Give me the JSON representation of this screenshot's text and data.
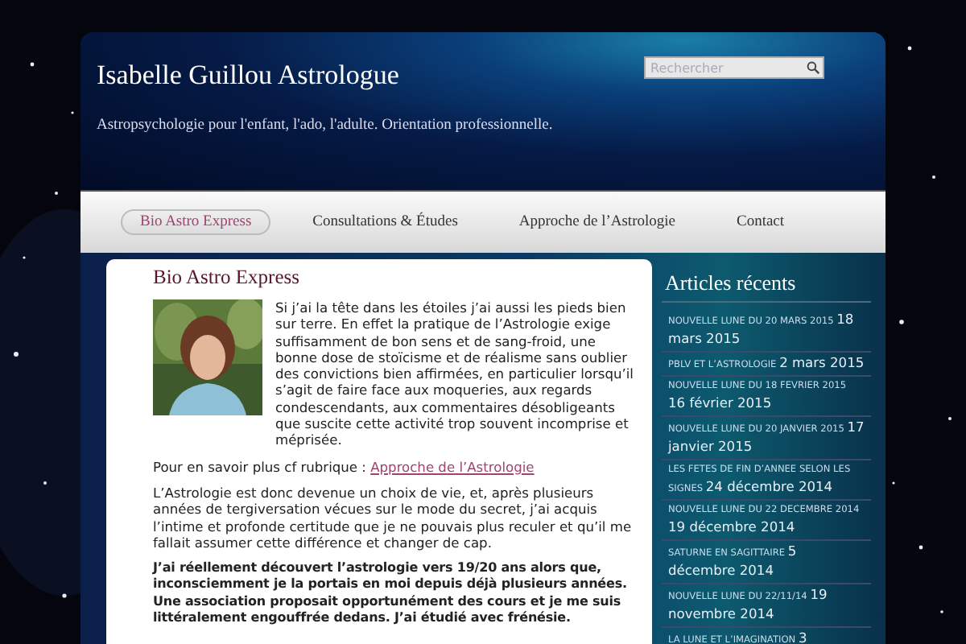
{
  "site": {
    "title": "Isabelle Guillou Astrologue",
    "tagline": "Astropsychologie pour l'enfant, l'ado, l'adulte. Orientation professionnelle.",
    "search": {
      "placeholder": "Rechercher"
    }
  },
  "nav": [
    {
      "label": "Bio Astro Express",
      "selected": true
    },
    {
      "label": "Consultations & Études",
      "selected": false
    },
    {
      "label": "Approche de l’Astrologie",
      "selected": false
    },
    {
      "label": "Contact",
      "selected": false
    }
  ],
  "article": {
    "title": "Bio Astro Express",
    "paragraphs": [
      {
        "text": "Si j’ai la tête dans les étoiles j’ai aussi les pieds bien sur terre. En effet la pratique de l’Astrologie exige suffisamment de bon sens et de sang-froid, une bonne dose de stoïcisme et de réalisme sans oublier des convictions bien affirmées, en particulier lorsqu’il s’agit de faire face aux moqueries, aux regards condescendants, aux commentaires désobligeants que suscite cette activité trop souvent incomprise et méprisée."
      },
      {
        "text": "Pour en savoir plus cf rubrique : ",
        "link": "Approche de l’Astrologie"
      },
      {
        "text": "L’Astrologie est donc devenue un choix de vie, et, après plusieurs années de tergiversation vécues sur le mode du secret, j’ai acquis l’intime et profonde certitude que je ne pouvais plus reculer et qu’il me fallait assumer cette différence et changer de cap."
      },
      {
        "text": "J’ai réellement découvert l’astrologie vers 19/20 ans alors que, inconsciemment je la portais en moi depuis déjà plusieurs années. Une association proposait opportunément des cours et je me suis littéralement engouffrée dedans. J’ai étudié avec frénésie."
      }
    ]
  },
  "sidebar": {
    "title": "Articles récents",
    "items": [
      {
        "title": "NOUVELLE LUNE DU 20 MARS 2015",
        "date": "18 mars 2015"
      },
      {
        "title": "PBLV ET L’ASTROLOGIE",
        "date": "2 mars 2015"
      },
      {
        "title": "NOUVELLE LUNE DU 18 FEVRIER 2015",
        "date": "16 février 2015"
      },
      {
        "title": "NOUVELLE LUNE DU 20 JANVIER 2015",
        "date": "17 janvier 2015"
      },
      {
        "title": "LES FETES DE FIN D’ANNEE SELON LES SIGNES",
        "date": "24 décembre 2014"
      },
      {
        "title": "NOUVELLE LUNE DU 22 DECEMBRE 2014",
        "date": "19 décembre 2014"
      },
      {
        "title": "SATURNE EN SAGITTAIRE",
        "date": "5 décembre 2014"
      },
      {
        "title": "NOUVELLE LUNE DU 22/11/14",
        "date": "19 novembre 2014"
      },
      {
        "title": "LA LUNE ET L’IMAGINATION",
        "date": "3"
      }
    ]
  }
}
